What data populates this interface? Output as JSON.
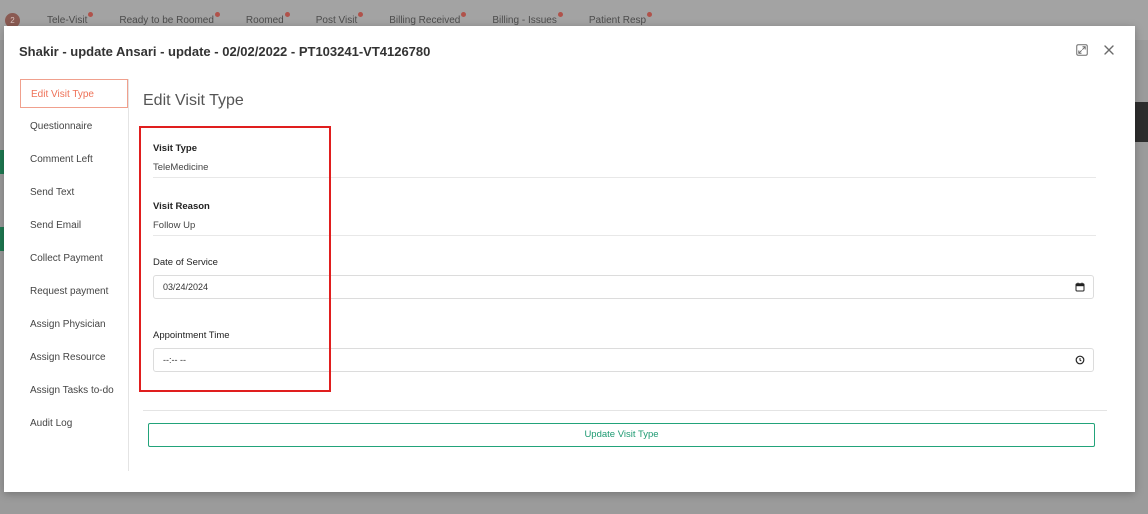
{
  "background_nav": {
    "badge": "2",
    "tabs": [
      "Tele-Visit",
      "Ready to be Roomed",
      "Roomed",
      "Post Visit",
      "Billing Received",
      "Billing - Issues",
      "Patient Resp"
    ]
  },
  "modal": {
    "title": "Shakir - update Ansari - update - 02/02/2022 - PT103241-VT4126780",
    "sidebar": [
      {
        "label": "Edit Visit Type",
        "active": true
      },
      {
        "label": "Questionnaire"
      },
      {
        "label": "Comment Left"
      },
      {
        "label": "Send Text"
      },
      {
        "label": "Send Email"
      },
      {
        "label": "Collect Payment"
      },
      {
        "label": "Request payment"
      },
      {
        "label": "Assign Physician"
      },
      {
        "label": "Assign Resource"
      },
      {
        "label": "Assign Tasks to-do"
      },
      {
        "label": "Audit Log"
      }
    ],
    "section_title": "Edit Visit Type",
    "visit_type": {
      "label": "Visit Type",
      "value": "TeleMedicine"
    },
    "visit_reason": {
      "label": "Visit Reason",
      "value": "Follow Up"
    },
    "date_of_service": {
      "label": "Date of Service",
      "value": "03/24/2024"
    },
    "appointment_time": {
      "label": "Appointment Time",
      "value": "--:-- --"
    },
    "update_button": "Update Visit Type"
  },
  "colors": {
    "accent_active": "#ee7157",
    "button_green": "#1e9a72",
    "highlight_red": "#e01e1e"
  },
  "icons": [
    "expand-icon",
    "close-icon",
    "calendar-icon",
    "clock-icon"
  ]
}
